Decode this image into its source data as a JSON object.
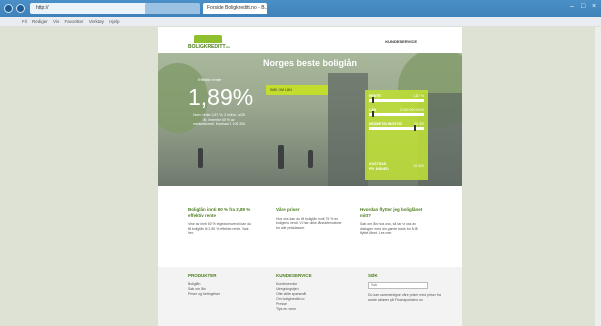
{
  "browser": {
    "address": "http://",
    "tab_title": "Forside Boligkreditt.no - B..."
  },
  "menubar": [
    "Fil",
    "Rediger",
    "Vis",
    "Favoritter",
    "Verktøy",
    "Hjelp"
  ],
  "header": {
    "logo": "BOLIGKREDITT",
    "logo_suffix": ".no",
    "customer_service": "KUNDESERVICE"
  },
  "hero": {
    "title": "Norges beste boliglån",
    "rate_label": "Effektiv rente",
    "rate": "1,89%",
    "rate_desc": "Nom. rente 1,87 %. 2 mill.kr. o/25 år, innenfor 60 % av markedsverdi. Kostnad 1 109 200",
    "apply_button": "SØK OM LÅN"
  },
  "calculator": {
    "rows": [
      {
        "label": "RENTE",
        "value": "1,87 %",
        "level": 0.05
      },
      {
        "label": "LÅN",
        "value": "2 000 000 NOK",
        "level": 0.05
      },
      {
        "label": "NEDBETALINGSTID",
        "value": "25 ÅR",
        "level": 0.85
      }
    ],
    "result_label_1": "KOSTNAD",
    "result_label_2": "PR. MÅNED",
    "result_value": "10 000"
  },
  "info": [
    {
      "title": "Boliglån innti 60 % fra 2,89 % effektiv rente",
      "text": "Vise av innti 60 % eigedomsverdi kan du få boliglån til 2,89 % effektiv rente. Søk her."
    },
    {
      "title": "Våre priser",
      "text": "Hos oss kan du få boliglån innti 75 % av boligens verdi. Vi har ulike lånealternativer for alle prisklasser."
    },
    {
      "title": "Hvordan flytter jeg boliglånet mitt?",
      "text": "Søk om lån hos oss, så tar vi oss av dialogen med din gamle bank for å få flyttet lånet. Les mer"
    }
  ],
  "footer": {
    "products": {
      "title": "PRODUKTER",
      "items": [
        "Boliglån",
        "Søk om lån",
        "Priser og betingelser"
      ]
    },
    "service": {
      "title": "KUNDESERVICE",
      "items": [
        "Kundeservice",
        "Utregningstjen",
        "Ofte stilte spørsmål",
        "Om boligkreditt.no",
        "Presse",
        "Tips en venn"
      ]
    },
    "search": {
      "title": "SØK",
      "placeholder": "Søk",
      "note": "Du kan sammenligne våre priser med priser fra andre aktører på Finansportalen.no"
    }
  }
}
